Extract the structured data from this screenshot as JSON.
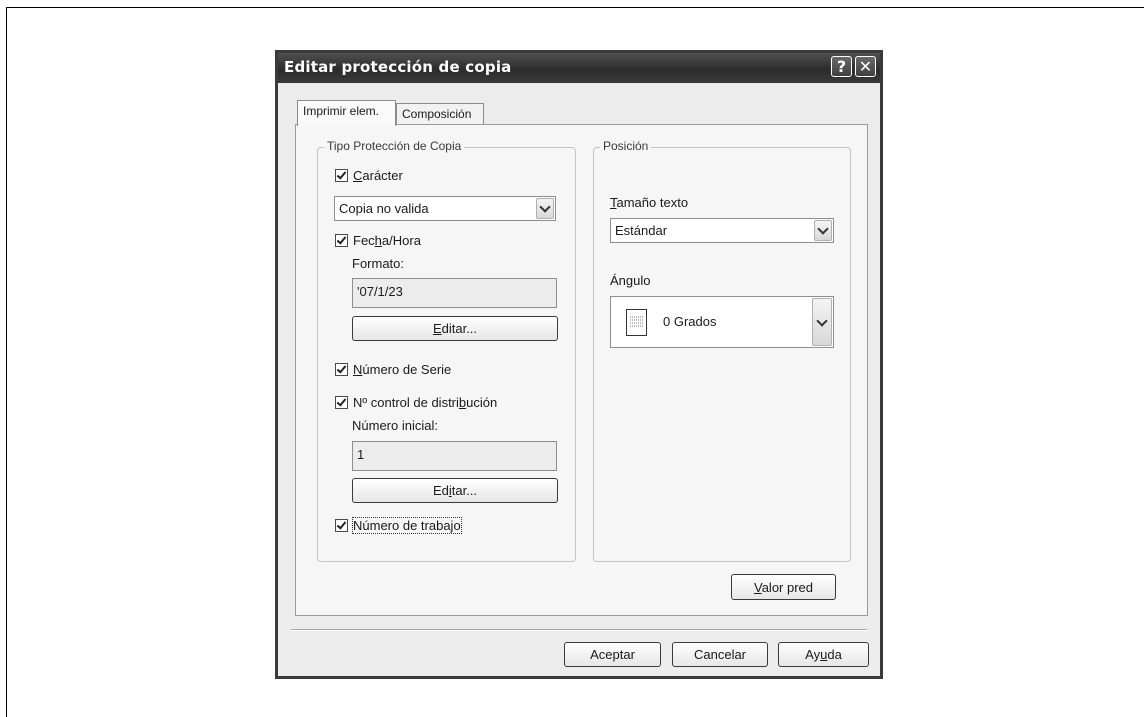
{
  "dialog": {
    "title": "Editar protección de copia",
    "help_label": "?",
    "close_label": "✕"
  },
  "tabs": [
    {
      "label": "Imprimir elem.",
      "active": true
    },
    {
      "label": "Composición",
      "active": false
    }
  ],
  "left_group": {
    "legend": "Tipo Protección de Copia",
    "character": {
      "label": "Carácter",
      "checked": true,
      "selected": "Copia no valida"
    },
    "datetime": {
      "label": "Fecha/Hora",
      "checked": true,
      "format_label": "Formato:",
      "format_value": "'07/1/23",
      "edit_label": "Editar..."
    },
    "serial": {
      "label": "Número de Serie",
      "checked": true
    },
    "distribution": {
      "label": "Nº control de distribución",
      "checked": true,
      "start_label": "Número inicial:",
      "start_value": "1",
      "edit_label": "Editar..."
    },
    "job_number": {
      "label": "Número de trabajo",
      "checked": true
    }
  },
  "right_group": {
    "legend": "Posición",
    "text_size_label": "Tamaño texto",
    "text_size_value": "Estándar",
    "angle_label": "Ángulo",
    "angle_value": "0 Grados",
    "angle_icon": "page-orientation-icon"
  },
  "buttons": {
    "default": "Valor pred",
    "ok": "Aceptar",
    "cancel": "Cancelar",
    "help": "Ayuda"
  }
}
